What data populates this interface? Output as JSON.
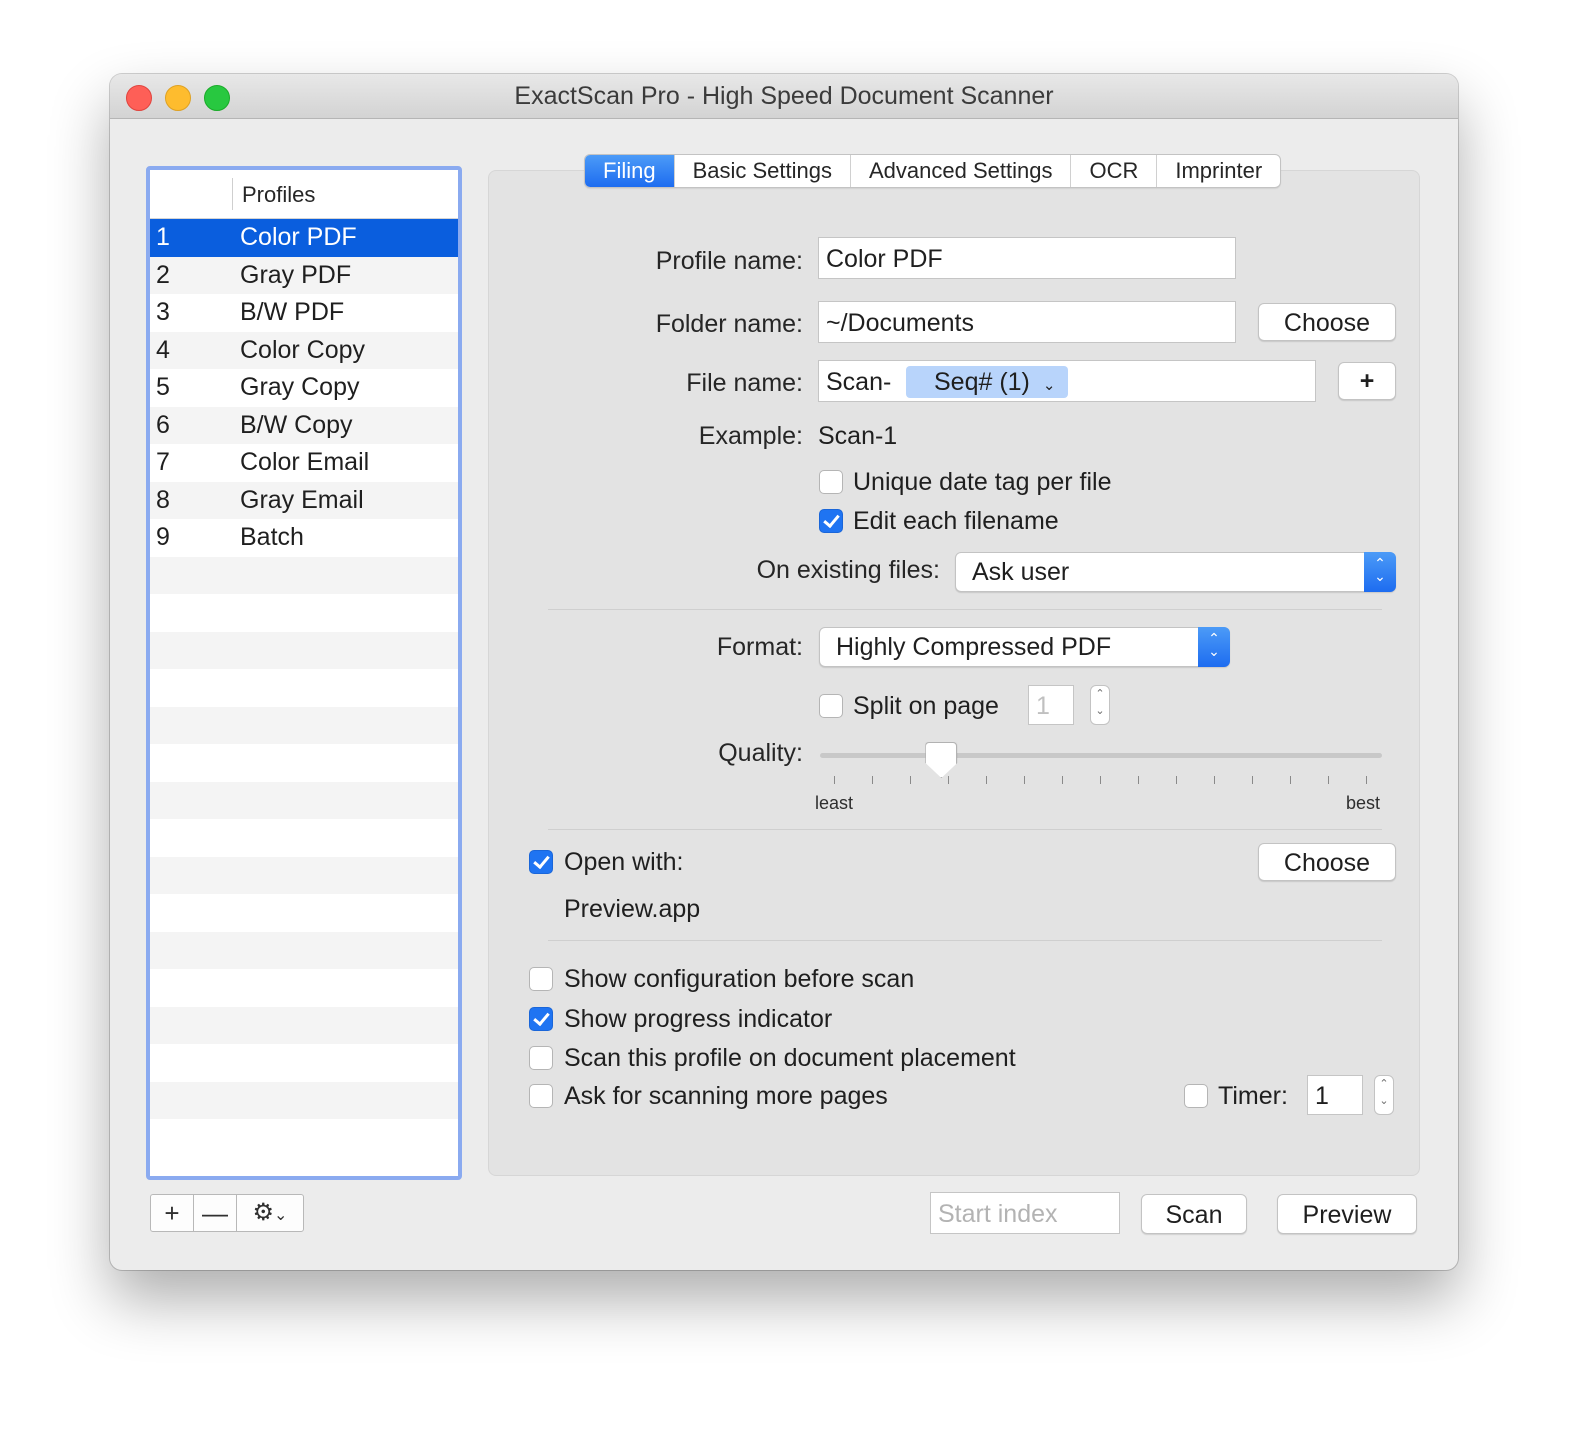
{
  "window": {
    "title": "ExactScan Pro - High Speed Document Scanner"
  },
  "profiles": {
    "header": "Profiles",
    "items": [
      {
        "index": "1",
        "name": "Color PDF"
      },
      {
        "index": "2",
        "name": "Gray PDF"
      },
      {
        "index": "3",
        "name": "B/W PDF"
      },
      {
        "index": "4",
        "name": "Color Copy"
      },
      {
        "index": "5",
        "name": "Gray Copy"
      },
      {
        "index": "6",
        "name": "B/W Copy"
      },
      {
        "index": "7",
        "name": "Color Email"
      },
      {
        "index": "8",
        "name": "Gray Email"
      },
      {
        "index": "9",
        "name": "Batch"
      }
    ],
    "selected_index": 0,
    "controls": {
      "add": "+",
      "remove": "—",
      "gear_menu": "⚙"
    }
  },
  "tabs": [
    "Filing",
    "Basic Settings",
    "Advanced Settings",
    "OCR",
    "Imprinter"
  ],
  "active_tab": "Filing",
  "filing": {
    "profile_name_label": "Profile name:",
    "profile_name": "Color PDF",
    "folder_name_label": "Folder name:",
    "folder_name": "~/Documents",
    "choose_label": "Choose",
    "file_name_label": "File name:",
    "file_name_prefix": "Scan-",
    "file_name_token": "Seq# (1)",
    "add_token": "+",
    "example_label": "Example:",
    "example_value": "Scan-1",
    "unique_date_tag": {
      "label": "Unique date tag per file",
      "checked": false
    },
    "edit_each_filename": {
      "label": "Edit each filename",
      "checked": true
    },
    "on_existing_label": "On existing files:",
    "on_existing_value": "Ask user",
    "format_label": "Format:",
    "format_value": "Highly Compressed PDF",
    "split_on_page": {
      "label": "Split on page",
      "checked": false,
      "value": "1"
    },
    "quality_label": "Quality:",
    "quality_min_label": "least",
    "quality_max_label": "best",
    "quality_level": 0.2,
    "open_with": {
      "label": "Open with:",
      "checked": true,
      "app": "Preview.app",
      "choose_label": "Choose"
    },
    "show_configuration": {
      "label": "Show configuration before scan",
      "checked": false
    },
    "show_progress": {
      "label": "Show progress indicator",
      "checked": true
    },
    "scan_on_placement": {
      "label": "Scan this profile on document placement",
      "checked": false
    },
    "ask_more_pages": {
      "label": "Ask for scanning more pages",
      "checked": false
    },
    "timer": {
      "label": "Timer:",
      "checked": false,
      "value": "1"
    }
  },
  "footer": {
    "start_index_placeholder": "Start index",
    "scan_label": "Scan",
    "preview_label": "Preview"
  },
  "colors": {
    "accent": "#1f74f2",
    "selection": "#0a5ede",
    "focus_ring": "#8aaaf0"
  }
}
